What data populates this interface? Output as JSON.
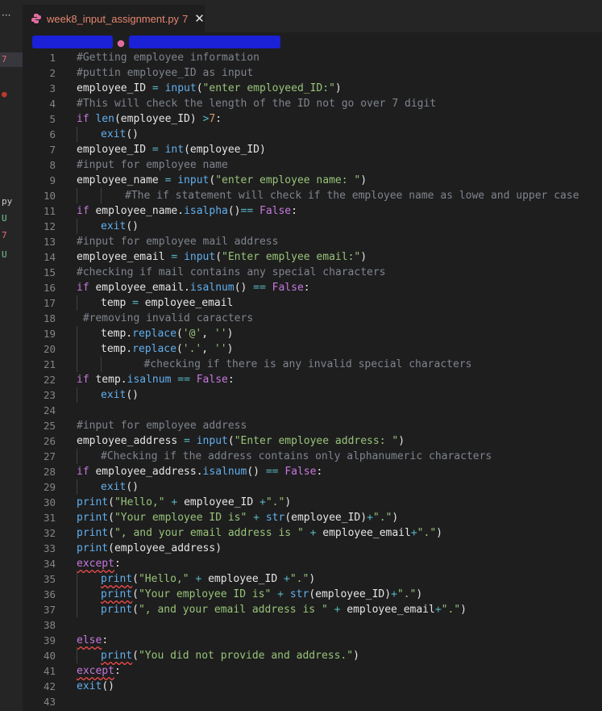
{
  "tab": {
    "filename": "week8_input_assignment.py",
    "problem_count": "7",
    "close_glyph": "✕"
  },
  "left_strip": {
    "items": [
      {
        "text": "7",
        "color": "#e06c75",
        "badge": true
      },
      {
        "text": "●",
        "color": "#c0392b",
        "badge": false
      },
      {
        "text": "py",
        "color": "#cccccc",
        "badge": false
      },
      {
        "text": "U",
        "color": "#73c991",
        "badge": false
      },
      {
        "text": "7",
        "color": "#e06c75",
        "badge": false
      },
      {
        "text": "U",
        "color": "#73c991",
        "badge": false
      }
    ]
  },
  "editor": {
    "lines": [
      {
        "n": "1",
        "indent": 0,
        "tokens": [
          [
            "cm",
            "#Getting employee information"
          ]
        ]
      },
      {
        "n": "2",
        "indent": 0,
        "tokens": [
          [
            "cm",
            "#puttin employee_ID as input"
          ]
        ]
      },
      {
        "n": "3",
        "indent": 0,
        "tokens": [
          [
            "id",
            "employee_ID"
          ],
          [
            "op",
            " = "
          ],
          [
            "fn",
            "input"
          ],
          [
            "pl",
            "("
          ],
          [
            "str",
            "\"enter employeed_ID:\""
          ],
          [
            "pl",
            ")"
          ]
        ]
      },
      {
        "n": "4",
        "indent": 0,
        "tokens": [
          [
            "cm",
            "#This will check the length of the ID not go over 7 digit"
          ]
        ]
      },
      {
        "n": "5",
        "indent": 0,
        "tokens": [
          [
            "kw",
            "if "
          ],
          [
            "fn",
            "len"
          ],
          [
            "pl",
            "(employee_ID) "
          ],
          [
            "op",
            ">"
          ],
          [
            "num",
            "7"
          ],
          [
            "pl",
            ":"
          ]
        ]
      },
      {
        "n": "6",
        "indent": 1,
        "tokens": [
          [
            "fn",
            "exit"
          ],
          [
            "pl",
            "()"
          ]
        ]
      },
      {
        "n": "7",
        "indent": 0,
        "tokens": [
          [
            "id",
            "employee_ID"
          ],
          [
            "op",
            " = "
          ],
          [
            "fn",
            "int"
          ],
          [
            "pl",
            "(employee_ID)"
          ]
        ]
      },
      {
        "n": "8",
        "indent": 0,
        "tokens": [
          [
            "cm",
            "#input for employee name"
          ]
        ]
      },
      {
        "n": "9",
        "indent": 0,
        "tokens": [
          [
            "id",
            "employee_name"
          ],
          [
            "op",
            " = "
          ],
          [
            "fn",
            "input"
          ],
          [
            "pl",
            "("
          ],
          [
            "str",
            "\"enter employee name: \""
          ],
          [
            "pl",
            ")"
          ]
        ]
      },
      {
        "n": "10",
        "indent": 2,
        "tokens": [
          [
            "cm",
            "#The if statement will check if the employee name as lowe and upper case"
          ]
        ]
      },
      {
        "n": "11",
        "indent": 0,
        "tokens": [
          [
            "kw",
            "if "
          ],
          [
            "pl",
            "employee_name."
          ],
          [
            "fn",
            "isalpha"
          ],
          [
            "pl",
            "()"
          ],
          [
            "op",
            "== "
          ],
          [
            "kw",
            "False"
          ],
          [
            "pl",
            ":"
          ]
        ]
      },
      {
        "n": "12",
        "indent": 1,
        "tokens": [
          [
            "fn",
            "exit"
          ],
          [
            "pl",
            "()"
          ]
        ]
      },
      {
        "n": "13",
        "indent": 0,
        "tokens": [
          [
            "cm",
            "#input for employee mail address"
          ]
        ]
      },
      {
        "n": "14",
        "indent": 0,
        "tokens": [
          [
            "id",
            "employee_email"
          ],
          [
            "op",
            " = "
          ],
          [
            "fn",
            "input"
          ],
          [
            "pl",
            "("
          ],
          [
            "str",
            "\"Enter emplyee email:\""
          ],
          [
            "pl",
            ")"
          ]
        ]
      },
      {
        "n": "15",
        "indent": 0,
        "tokens": [
          [
            "cm",
            "#checking if mail contains any special characters"
          ]
        ]
      },
      {
        "n": "16",
        "indent": 0,
        "tokens": [
          [
            "kw",
            "if "
          ],
          [
            "pl",
            "employee_email."
          ],
          [
            "fn",
            "isalnum"
          ],
          [
            "pl",
            "() "
          ],
          [
            "op",
            "== "
          ],
          [
            "kw",
            "False"
          ],
          [
            "pl",
            ":"
          ]
        ]
      },
      {
        "n": "17",
        "indent": 1,
        "tokens": [
          [
            "id",
            "temp"
          ],
          [
            "op",
            " = "
          ],
          [
            "pl",
            "employee_email"
          ]
        ]
      },
      {
        "n": "18",
        "indent": 0,
        "tokens": [
          [
            "cm",
            " #removing invalid caracters"
          ]
        ]
      },
      {
        "n": "19",
        "indent": 1,
        "tokens": [
          [
            "pl",
            "temp."
          ],
          [
            "fn",
            "replace"
          ],
          [
            "pl",
            "("
          ],
          [
            "str",
            "'@'"
          ],
          [
            "pl",
            ", "
          ],
          [
            "str",
            "''"
          ],
          [
            "pl",
            ")"
          ]
        ]
      },
      {
        "n": "20",
        "indent": 1,
        "tokens": [
          [
            "pl",
            "temp."
          ],
          [
            "fn",
            "replace"
          ],
          [
            "pl",
            "("
          ],
          [
            "str",
            "'.'"
          ],
          [
            "pl",
            ", "
          ],
          [
            "str",
            "''"
          ],
          [
            "pl",
            ")"
          ]
        ]
      },
      {
        "n": "21",
        "indent": 2,
        "tokens": [
          [
            "cm",
            "   #checking if there is any invalid special characters"
          ]
        ]
      },
      {
        "n": "22",
        "indent": 0,
        "tokens": [
          [
            "kw",
            "if "
          ],
          [
            "pl",
            "temp."
          ],
          [
            "fn",
            "isalnum"
          ],
          [
            "op",
            " == "
          ],
          [
            "kw",
            "False"
          ],
          [
            "pl",
            ":"
          ]
        ]
      },
      {
        "n": "23",
        "indent": 1,
        "tokens": [
          [
            "fn",
            "exit"
          ],
          [
            "pl",
            "()"
          ]
        ]
      },
      {
        "n": "24",
        "indent": 0,
        "tokens": []
      },
      {
        "n": "25",
        "indent": 0,
        "tokens": [
          [
            "cm",
            "#input for employee address"
          ]
        ]
      },
      {
        "n": "26",
        "indent": 0,
        "tokens": [
          [
            "id",
            "employee_address"
          ],
          [
            "op",
            " = "
          ],
          [
            "fn",
            "input"
          ],
          [
            "pl",
            "("
          ],
          [
            "str",
            "\"Enter employee address: \""
          ],
          [
            "pl",
            ")"
          ]
        ]
      },
      {
        "n": "27",
        "indent": 1,
        "tokens": [
          [
            "cm",
            "#Checking if the address contains only alphanumeric characters"
          ]
        ]
      },
      {
        "n": "28",
        "indent": 0,
        "tokens": [
          [
            "kw",
            "if "
          ],
          [
            "pl",
            "employee_address."
          ],
          [
            "fn",
            "isalnum"
          ],
          [
            "pl",
            "() "
          ],
          [
            "op",
            "== "
          ],
          [
            "kw",
            "False"
          ],
          [
            "pl",
            ":"
          ]
        ]
      },
      {
        "n": "29",
        "indent": 1,
        "tokens": [
          [
            "fn",
            "exit"
          ],
          [
            "pl",
            "()"
          ]
        ]
      },
      {
        "n": "30",
        "indent": 0,
        "tokens": [
          [
            "fn",
            "print"
          ],
          [
            "pl",
            "("
          ],
          [
            "str",
            "\"Hello,\""
          ],
          [
            "op",
            " + "
          ],
          [
            "pl",
            "employee_ID "
          ],
          [
            "op",
            "+"
          ],
          [
            "str",
            "\".\""
          ],
          [
            "pl",
            ")"
          ]
        ]
      },
      {
        "n": "31",
        "indent": 0,
        "tokens": [
          [
            "fn",
            "print"
          ],
          [
            "pl",
            "("
          ],
          [
            "str",
            "\"Your employee ID is\""
          ],
          [
            "op",
            " + "
          ],
          [
            "fn",
            "str"
          ],
          [
            "pl",
            "(employee_ID)"
          ],
          [
            "op",
            "+"
          ],
          [
            "str",
            "\".\""
          ],
          [
            "pl",
            ")"
          ]
        ]
      },
      {
        "n": "32",
        "indent": 0,
        "tokens": [
          [
            "fn",
            "print"
          ],
          [
            "pl",
            "("
          ],
          [
            "str",
            "\", and your email address is \""
          ],
          [
            "op",
            " + "
          ],
          [
            "pl",
            "employee_email"
          ],
          [
            "op",
            "+"
          ],
          [
            "str",
            "\".\""
          ],
          [
            "pl",
            ")"
          ]
        ]
      },
      {
        "n": "33",
        "indent": 0,
        "tokens": [
          [
            "fn",
            "print"
          ],
          [
            "pl",
            "(employee_address)"
          ]
        ]
      },
      {
        "n": "34",
        "indent": 0,
        "tokens": [
          [
            "kw err",
            "except"
          ],
          [
            "pl",
            ":"
          ]
        ]
      },
      {
        "n": "35",
        "indent": 1,
        "tokens": [
          [
            "fn err",
            "print"
          ],
          [
            "pl",
            "("
          ],
          [
            "str",
            "\"Hello,\""
          ],
          [
            "op",
            " + "
          ],
          [
            "pl",
            "employee_ID "
          ],
          [
            "op",
            "+"
          ],
          [
            "str",
            "\".\""
          ],
          [
            "pl",
            ")"
          ]
        ]
      },
      {
        "n": "36",
        "indent": 1,
        "tokens": [
          [
            "fn err",
            "print"
          ],
          [
            "pl",
            "("
          ],
          [
            "str",
            "\"Your employee ID is\""
          ],
          [
            "op",
            " + "
          ],
          [
            "fn",
            "str"
          ],
          [
            "pl",
            "(employee_ID)"
          ],
          [
            "op",
            "+"
          ],
          [
            "str",
            "\".\""
          ],
          [
            "pl",
            ")"
          ]
        ]
      },
      {
        "n": "37",
        "indent": 1,
        "tokens": [
          [
            "fn",
            "print"
          ],
          [
            "pl",
            "("
          ],
          [
            "str",
            "\", and your email address is \""
          ],
          [
            "op",
            " + "
          ],
          [
            "pl",
            "employee_email"
          ],
          [
            "op",
            "+"
          ],
          [
            "str",
            "\".\""
          ],
          [
            "pl",
            ")"
          ]
        ]
      },
      {
        "n": "38",
        "indent": 0,
        "tokens": []
      },
      {
        "n": "39",
        "indent": 0,
        "tokens": [
          [
            "kw err",
            "else"
          ],
          [
            "pl",
            ":"
          ]
        ]
      },
      {
        "n": "40",
        "indent": 1,
        "tokens": [
          [
            "fn err",
            "print"
          ],
          [
            "pl",
            "("
          ],
          [
            "str",
            "\"You did not provide and address.\""
          ],
          [
            "pl",
            ")"
          ]
        ]
      },
      {
        "n": "41",
        "indent": 0,
        "tokens": [
          [
            "kw err",
            "except"
          ],
          [
            "pl",
            ":"
          ]
        ]
      },
      {
        "n": "42",
        "indent": 0,
        "tokens": [
          [
            "fn",
            "exit"
          ],
          [
            "pl",
            "()"
          ]
        ]
      },
      {
        "n": "43",
        "indent": 0,
        "tokens": []
      }
    ]
  }
}
